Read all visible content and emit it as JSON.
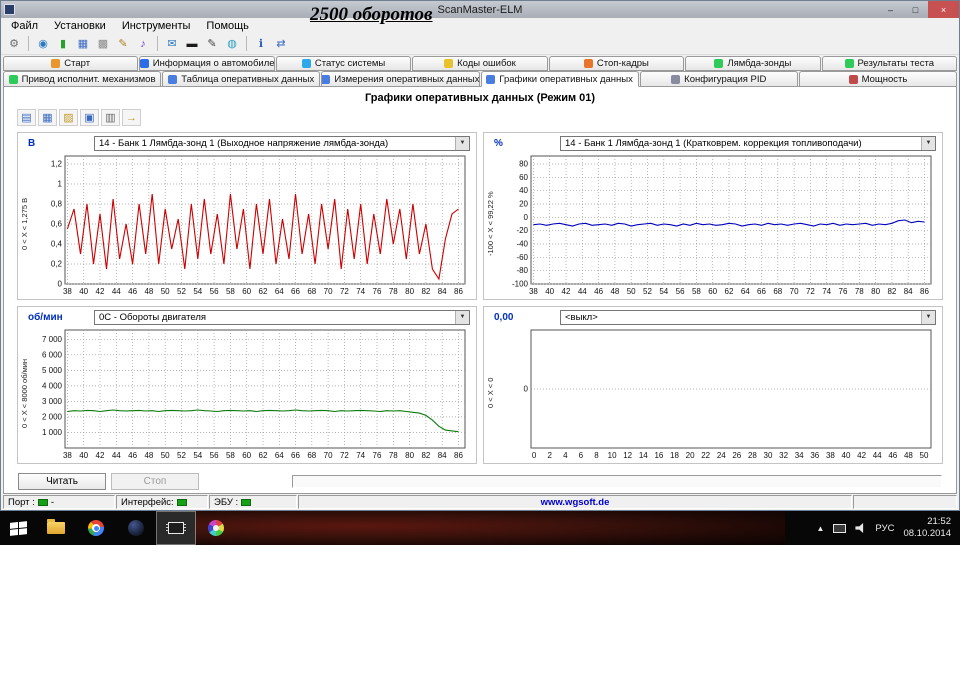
{
  "annotation": "2500 оборотов",
  "window": {
    "title": "ScanMaster-ELM",
    "menu": [
      "Файл",
      "Установки",
      "Инструменты",
      "Помощь"
    ],
    "controls": {
      "minimize": "–",
      "restore": "□",
      "close": "×"
    }
  },
  "toolbar": {
    "items": [
      {
        "name": "tools-icon",
        "glyph": "⚙",
        "color": "#6d6d6d"
      },
      {
        "sep": true
      },
      {
        "name": "globe-icon",
        "glyph": "◉",
        "color": "#2a7ac0"
      },
      {
        "name": "connect-icon",
        "glyph": "▮",
        "color": "#2aa02a"
      },
      {
        "name": "table-icon",
        "glyph": "▦",
        "color": "#3a6ac0"
      },
      {
        "name": "calculator-icon",
        "glyph": "▩",
        "color": "#8a8a8a"
      },
      {
        "name": "notes-icon",
        "glyph": "✎",
        "color": "#b08020"
      },
      {
        "name": "music-icon",
        "glyph": "♪",
        "color": "#7a3ac0"
      },
      {
        "sep": true
      },
      {
        "name": "chat-icon",
        "glyph": "✉",
        "color": "#2a7ac0"
      },
      {
        "name": "display-icon",
        "glyph": "▬",
        "color": "#1a1a1a"
      },
      {
        "name": "pen-icon",
        "glyph": "✎",
        "color": "#444444"
      },
      {
        "name": "globe-small-icon",
        "glyph": "◍",
        "color": "#2aa0c0"
      },
      {
        "sep": true
      },
      {
        "name": "info-icon",
        "glyph": "ℹ",
        "color": "#2a5ac0"
      },
      {
        "name": "usb-icon",
        "glyph": "⇄",
        "color": "#3a6ac0"
      }
    ]
  },
  "tabs_row1": [
    {
      "label": "Старт",
      "icon": "start-icon",
      "color": "#e8962e"
    },
    {
      "label": "Информация о автомобиле",
      "icon": "vehicle-info-icon",
      "color": "#2e6be8"
    },
    {
      "label": "Статус системы",
      "icon": "system-status-icon",
      "color": "#2ea8e8"
    },
    {
      "label": "Коды ошибок",
      "icon": "trouble-codes-icon",
      "color": "#e8c22e"
    },
    {
      "label": "Стоп-кадры",
      "icon": "freeze-frames-icon",
      "color": "#e8742e"
    },
    {
      "label": "Лямбда-зонды",
      "icon": "lambda-sensors-icon",
      "color": "#2ecb5a"
    },
    {
      "label": "Результаты теста",
      "icon": "test-results-icon",
      "color": "#2ecb5a"
    }
  ],
  "tabs_row2": [
    {
      "label": "Привод исполнит. механизмов",
      "icon": "actuators-icon",
      "color": "#2ecb5a"
    },
    {
      "label": "Таблица оперативных данных",
      "icon": "live-data-table-icon",
      "color": "#4a7de0"
    },
    {
      "label": "Измерения оперативных данных",
      "icon": "live-data-measure-icon",
      "color": "#4a7de0"
    },
    {
      "label": "Графики оперативных данных",
      "icon": "live-data-graphs-icon",
      "color": "#4a7de0",
      "active": true
    },
    {
      "label": "Конфигурация PID",
      "icon": "pid-config-icon",
      "color": "#8a8aa0"
    },
    {
      "label": "Мощность",
      "icon": "power-icon",
      "color": "#c04a4a"
    }
  ],
  "content": {
    "header": "Графики оперативных данных (Режим 01)",
    "read_button": "Читать",
    "stop_button": "Стоп"
  },
  "chart_toolbar": [
    {
      "name": "chart-style-icon",
      "glyph": "▤",
      "color": "#3a6ac0"
    },
    {
      "name": "chart-grid-icon",
      "glyph": "▦",
      "color": "#3a6ac0"
    },
    {
      "name": "open-icon",
      "glyph": "▨",
      "color": "#c09a2a"
    },
    {
      "name": "save-icon",
      "glyph": "▣",
      "color": "#3a6ac0"
    },
    {
      "name": "print-icon",
      "glyph": "▥",
      "color": "#666666"
    },
    {
      "name": "export-icon",
      "glyph": "→",
      "color": "#c09a2a"
    }
  ],
  "chart_data": [
    {
      "type": "line",
      "id": "lambda-voltage",
      "unit": "В",
      "dropdown": "14 - Банк 1 Лямбда-зонд 1 (Выходное напряжение лямбда-зонда)",
      "range_label": "0  < X <  1,275 В",
      "color": "#cc0000",
      "xlim": [
        37.7,
        86.8
      ],
      "ylim": [
        0,
        1.28
      ],
      "xticks": [
        38,
        40,
        42,
        44,
        46,
        48,
        50,
        52,
        54,
        56,
        58,
        60,
        62,
        64,
        66,
        68,
        70,
        72,
        74,
        76,
        78,
        80,
        82,
        84,
        86
      ],
      "yticks": [
        {
          "v": 1.2,
          "l": "1,2"
        },
        {
          "v": 1,
          "l": "1"
        },
        {
          "v": 0.8,
          "l": "0,8"
        },
        {
          "v": 0.6,
          "l": "0,6"
        },
        {
          "v": 0.4,
          "l": "0,4"
        },
        {
          "v": 0.2,
          "l": "0,2"
        },
        {
          "v": 0,
          "l": "0"
        }
      ],
      "xgrid": true,
      "ygrid": true,
      "x_start": 38,
      "x_step": 0.8,
      "y": [
        0.55,
        0.75,
        0.3,
        0.8,
        0.2,
        0.7,
        0.15,
        0.85,
        0.25,
        0.6,
        0.2,
        0.8,
        0.3,
        0.9,
        0.2,
        0.75,
        0.35,
        0.65,
        0.15,
        0.8,
        0.25,
        0.85,
        0.3,
        0.7,
        0.2,
        0.9,
        0.35,
        0.75,
        0.15,
        0.8,
        0.3,
        0.85,
        0.2,
        0.65,
        0.25,
        0.9,
        0.3,
        0.7,
        0.2,
        0.8,
        0.35,
        0.85,
        0.15,
        0.75,
        0.25,
        0.8,
        0.2,
        0.7,
        0.3,
        0.85,
        0.4,
        0.75,
        0.25,
        0.8,
        0.3,
        0.6,
        0.15,
        0.05,
        0.45,
        0.7,
        0.75
      ]
    },
    {
      "type": "line",
      "id": "short-term-fuel-trim",
      "unit": "%",
      "dropdown": "14 - Банк 1 Лямбда-зонд 1 (Кратковрем. коррекция топливоподачи)",
      "range_label": "-100  < X <  99,22 %",
      "color": "#0000bb",
      "xlim": [
        37.7,
        86.8
      ],
      "ylim": [
        -100,
        92
      ],
      "xticks": [
        38,
        40,
        42,
        44,
        46,
        48,
        50,
        52,
        54,
        56,
        58,
        60,
        62,
        64,
        66,
        68,
        70,
        72,
        74,
        76,
        78,
        80,
        82,
        84,
        86
      ],
      "yticks": [
        {
          "v": 80,
          "l": "80"
        },
        {
          "v": 60,
          "l": "60"
        },
        {
          "v": 40,
          "l": "40"
        },
        {
          "v": 20,
          "l": "20"
        },
        {
          "v": 0,
          "l": "0"
        },
        {
          "v": -20,
          "l": "-20"
        },
        {
          "v": -40,
          "l": "-40"
        },
        {
          "v": -60,
          "l": "-60"
        },
        {
          "v": -80,
          "l": "-80"
        },
        {
          "v": -100,
          "l": "-100"
        }
      ],
      "xgrid": true,
      "ygrid": true,
      "x_start": 38,
      "x_step": 0.8,
      "y": [
        -11,
        -10,
        -12,
        -10,
        -9,
        -11,
        -13,
        -10,
        -9,
        -12,
        -11,
        -10,
        -12,
        -9,
        -10,
        -13,
        -11,
        -10,
        -9,
        -12,
        -10,
        -11,
        -13,
        -10,
        -12,
        -9,
        -11,
        -10,
        -12,
        -11,
        -9,
        -10,
        -13,
        -11,
        -10,
        -12,
        -9,
        -11,
        -10,
        -12,
        -10,
        -9,
        -11,
        -13,
        -10,
        -11,
        -9,
        -12,
        -10,
        -11,
        -10,
        -9,
        -12,
        -10,
        -11,
        -9,
        -5,
        -4,
        -8,
        -6,
        -7
      ]
    },
    {
      "type": "line",
      "id": "engine-rpm",
      "unit": "об/мин",
      "dropdown": "0C - Обороты двигателя",
      "range_label": "0  < X <  8000 об/мин",
      "color": "#0a7a0a",
      "xlim": [
        37.7,
        86.8
      ],
      "ylim": [
        0,
        7600
      ],
      "xticks": [
        38,
        40,
        42,
        44,
        46,
        48,
        50,
        52,
        54,
        56,
        58,
        60,
        62,
        64,
        66,
        68,
        70,
        72,
        74,
        76,
        78,
        80,
        82,
        84,
        86
      ],
      "yticks": [
        {
          "v": 7000,
          "l": "7 000"
        },
        {
          "v": 6000,
          "l": "6 000"
        },
        {
          "v": 5000,
          "l": "5 000"
        },
        {
          "v": 4000,
          "l": "4 000"
        },
        {
          "v": 3000,
          "l": "3 000"
        },
        {
          "v": 2000,
          "l": "2 000"
        },
        {
          "v": 1000,
          "l": "1 000"
        }
      ],
      "xgrid": true,
      "ygrid": true,
      "x_start": 38,
      "x_step": 0.8,
      "y": [
        2350,
        2400,
        2380,
        2420,
        2400,
        2350,
        2400,
        2450,
        2400,
        2380,
        2400,
        2420,
        2380,
        2400,
        2350,
        2400,
        2420,
        2400,
        2380,
        2400,
        2450,
        2400,
        2380,
        2350,
        2400,
        2420,
        2400,
        2380,
        2400,
        2350,
        2400,
        2420,
        2400,
        2380,
        2400,
        2450,
        2400,
        2380,
        2400,
        2420,
        2400,
        2350,
        2400,
        2380,
        2400,
        2420,
        2400,
        2380,
        2350,
        2400,
        2380,
        2400,
        2350,
        2300,
        2250,
        2100,
        1800,
        1400,
        1150,
        1100,
        1050
      ]
    },
    {
      "type": "line",
      "id": "channel-off",
      "unit": "0,00",
      "dropdown": "<выкл>",
      "range_label": "0  < X <  0",
      "color": "#0000bb",
      "xlim": [
        -0.4,
        50.9
      ],
      "ylim": [
        -1,
        1
      ],
      "xticks": [
        0,
        2,
        4,
        6,
        8,
        10,
        12,
        14,
        16,
        18,
        20,
        22,
        24,
        26,
        28,
        30,
        32,
        34,
        36,
        38,
        40,
        42,
        44,
        46,
        48,
        50
      ],
      "yticks": [
        {
          "v": 0,
          "l": "0"
        }
      ],
      "xgrid": false,
      "ygrid": true,
      "x_start": 0,
      "x_step": 1,
      "y": []
    }
  ],
  "statusbar": {
    "port_label": "Порт :",
    "port_value": "-",
    "interface_label": "Интерфейс:",
    "ecu_label": "ЭБУ :",
    "website": "www.wgsoft.de"
  },
  "taskbar": {
    "pinned": [
      {
        "name": "file-explorer-icon"
      },
      {
        "name": "chrome-icon"
      },
      {
        "name": "browser-icon"
      },
      {
        "name": "scanmaster-app-icon",
        "active": true
      },
      {
        "name": "graphics-app-icon"
      }
    ],
    "tray": {
      "expand": "▲",
      "lang": "РУС",
      "time": "21:52",
      "date": "08.10.2014"
    }
  }
}
